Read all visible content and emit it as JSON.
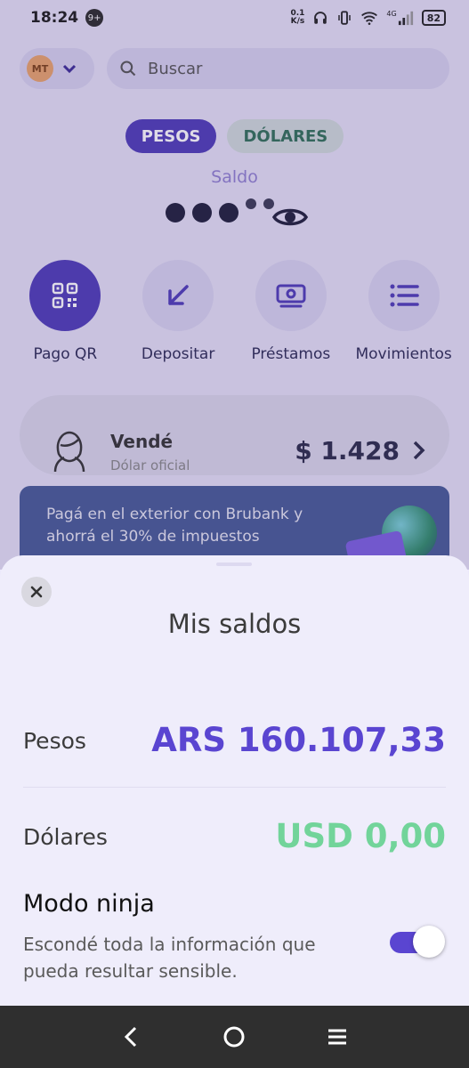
{
  "status_bar": {
    "time": "18:24",
    "notification_count": "9+",
    "speed_value": "0.1",
    "speed_unit": "K/s",
    "network": "4G",
    "battery": "82"
  },
  "header": {
    "avatar_initials": "MT",
    "search_placeholder": "Buscar"
  },
  "currency_tabs": {
    "active": "PESOS",
    "inactive": "DÓLARES"
  },
  "balance": {
    "label": "Saldo"
  },
  "actions": [
    {
      "label": "Pago QR",
      "icon": "qr-icon"
    },
    {
      "label": "Depositar",
      "icon": "arrow-down-left-icon"
    },
    {
      "label": "Préstamos",
      "icon": "money-icon"
    },
    {
      "label": "Movimientos",
      "icon": "list-icon"
    }
  ],
  "sell_card": {
    "title": "Vendé",
    "subtitle": "Dólar oficial",
    "value": "$ 1.428"
  },
  "promo": {
    "text": "Pagá en el exterior con Brubank y ahorrá el 30% de impuestos"
  },
  "sheet": {
    "title": "Mis saldos",
    "pesos_label": "Pesos",
    "pesos_value": "ARS 160.107,33",
    "dolares_label": "Dólares",
    "dolares_value": "USD 0,00",
    "ninja_title": "Modo ninja",
    "ninja_description": "Escondé toda la información que pueda resultar sensible.",
    "ninja_enabled": true
  },
  "colors": {
    "accent": "#5a45d1",
    "usd_green": "#72d49a"
  }
}
